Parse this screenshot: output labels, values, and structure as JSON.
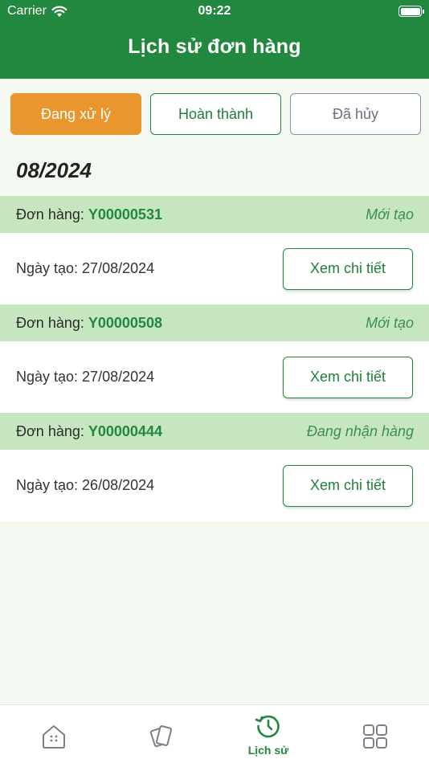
{
  "status_bar": {
    "carrier": "Carrier",
    "time": "09:22"
  },
  "header": {
    "title": "Lịch sử đơn hàng"
  },
  "tabs": [
    {
      "label": "Đang xử lý",
      "active": true
    },
    {
      "label": "Hoàn thành",
      "active": false
    },
    {
      "label": "Đã hủy",
      "active": false
    }
  ],
  "month": "08/2024",
  "orders": [
    {
      "label": "Đơn hàng:",
      "id": "Y00000531",
      "status": "Mới tạo",
      "created": "Ngày tạo: 27/08/2024",
      "button": "Xem chi tiết"
    },
    {
      "label": "Đơn hàng:",
      "id": "Y00000508",
      "status": "Mới tạo",
      "created": "Ngày tạo: 27/08/2024",
      "button": "Xem chi tiết"
    },
    {
      "label": "Đơn hàng:",
      "id": "Y00000444",
      "status": "Đang nhận hàng",
      "created": "Ngày tạo: 26/08/2024",
      "button": "Xem chi tiết"
    }
  ],
  "bottom_nav": [
    {
      "icon": "home-icon",
      "label": ""
    },
    {
      "icon": "cards-icon",
      "label": ""
    },
    {
      "icon": "history-icon",
      "label": "Lịch sử",
      "active": true
    },
    {
      "icon": "grid-icon",
      "label": ""
    }
  ],
  "colors": {
    "brand_green": "#22883f",
    "accent_orange": "#e9962e",
    "order_header_bg": "#c6e6c0"
  }
}
